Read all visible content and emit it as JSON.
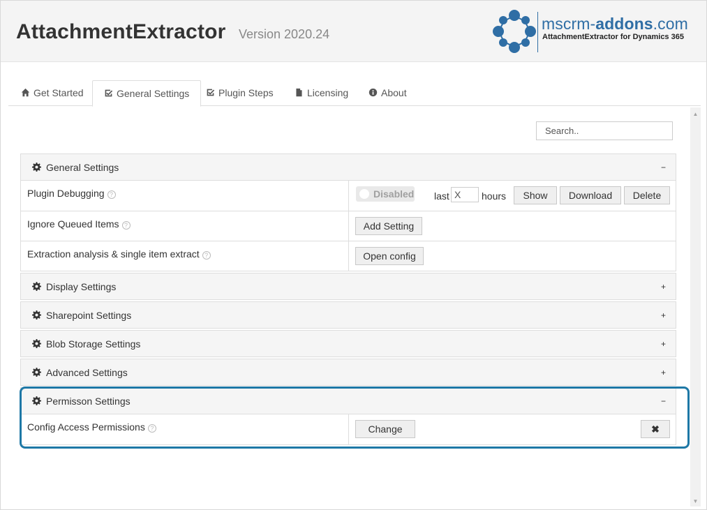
{
  "header": {
    "title": "AttachmentExtractor",
    "version": "Version 2020.24",
    "logo": {
      "brand_prefix": "mscrm-",
      "brand_bold": "addons",
      "brand_suffix": ".com",
      "subtitle": "AttachmentExtractor for Dynamics 365",
      "color": "#2f6ea5"
    }
  },
  "tabs": [
    {
      "label": "Get Started",
      "icon": "home-icon",
      "active": false
    },
    {
      "label": "General Settings",
      "icon": "edit-check-icon",
      "active": true
    },
    {
      "label": "Plugin Steps",
      "icon": "edit-check-icon",
      "active": false
    },
    {
      "label": "Licensing",
      "icon": "file-icon",
      "active": false
    },
    {
      "label": "About",
      "icon": "info-icon",
      "active": false
    }
  ],
  "search": {
    "placeholder": "Search.."
  },
  "panels": {
    "general": {
      "title": "General Settings",
      "toggle": "−",
      "rows": {
        "plugin_debugging": {
          "label": "Plugin Debugging",
          "switch_label": "Disabled",
          "last_label": "last",
          "hours_placeholder": "X",
          "hours_label": "hours",
          "show_label": "Show",
          "download_label": "Download",
          "delete_label": "Delete"
        },
        "ignore_queued": {
          "label": "Ignore Queued Items",
          "button": "Add Setting"
        },
        "extraction": {
          "label": "Extraction analysis & single item extract",
          "button": "Open config"
        }
      }
    },
    "display": {
      "title": "Display Settings",
      "toggle": "+"
    },
    "sharepoint": {
      "title": "Sharepoint Settings",
      "toggle": "+"
    },
    "blob": {
      "title": "Blob Storage Settings",
      "toggle": "+"
    },
    "advanced": {
      "title": "Advanced Settings",
      "toggle": "+"
    },
    "permission": {
      "title": "Permisson Settings",
      "toggle": "−",
      "rows": {
        "config_access": {
          "label": "Config Access Permissions",
          "button": "Change",
          "clear_button": "✖"
        }
      }
    }
  },
  "help_glyph": "?",
  "colors": {
    "highlight": "#1e78a6",
    "panel_header_bg": "#f5f5f5",
    "header_bg": "#f4f4f4"
  }
}
